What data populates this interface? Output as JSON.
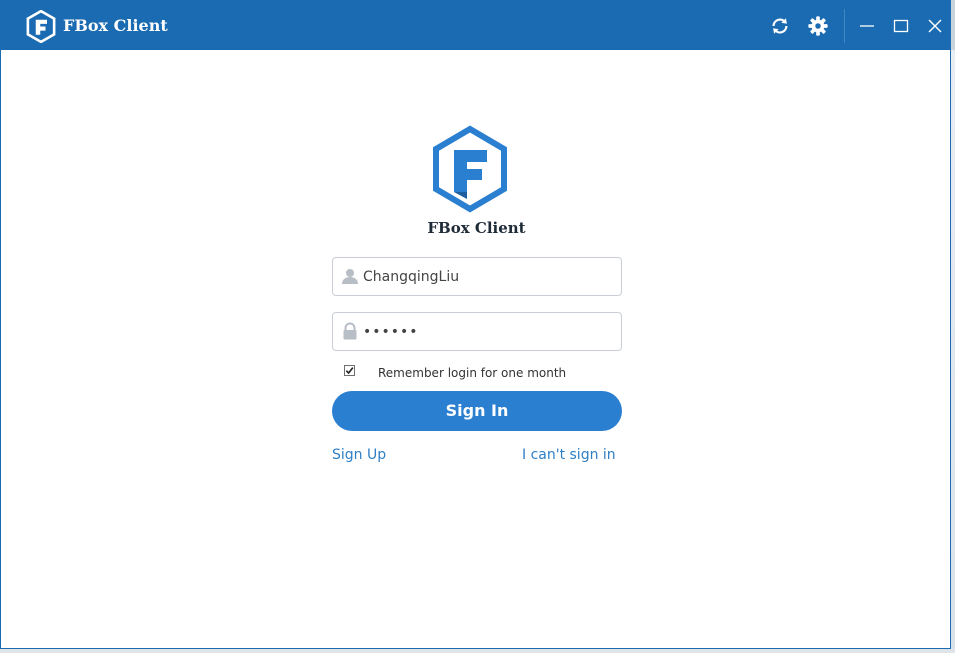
{
  "window": {
    "title": "FBox Client"
  },
  "toolbar": {
    "icons": [
      "refresh-icon",
      "gear-icon",
      "minimize-icon",
      "maximize-icon",
      "close-icon"
    ]
  },
  "login": {
    "brand": "FBox Client",
    "username_value": "ChangqingLiu",
    "password_value": "••••••",
    "remember_checked": true,
    "remember_label": "Remember login for one month",
    "signin_label": "Sign In",
    "signup_label": "Sign Up",
    "cant_signin_label": "I can't sign in"
  },
  "colors": {
    "titlebar": "#1a6bb1",
    "accent": "#2a7fd0",
    "link": "#2f7fc5"
  }
}
